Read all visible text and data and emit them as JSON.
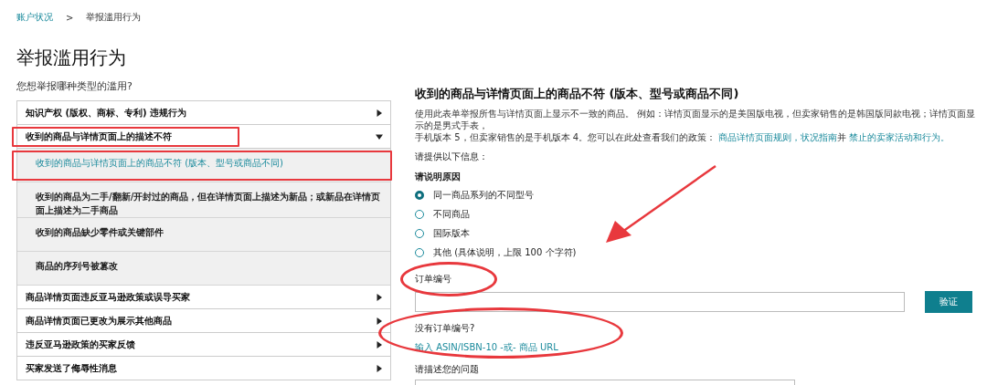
{
  "breadcrumb": [
    {
      "label": "账户状况",
      "kind": "link"
    },
    {
      "label": ">",
      "kind": "separator"
    },
    {
      "label": "举报滥用行为",
      "kind": "current"
    }
  ],
  "title": "举报滥用行为",
  "question": "您想举报哪种类型的滥用?",
  "categories": [
    {
      "label": "知识产权 (版权、商标、专利) 违规行为",
      "expanded": false
    },
    {
      "label": "收到的商品与详情页面上的描述不符",
      "expanded": true,
      "children": [
        {
          "label": "收到的商品与详情页面上的商品不符 (版本、型号或商品不同)",
          "selected": true
        },
        {
          "label": "收到的商品为二手/翻新/开封过的商品，但在详情页面上描述为新品；或新品在详情页面上描述为二手商品",
          "selected": false
        },
        {
          "label": "收到的商品缺少零件或关键部件",
          "selected": false
        },
        {
          "label": "商品的序列号被篡改",
          "selected": false
        }
      ]
    },
    {
      "label": "商品详情页面违反亚马逊政策或误导买家",
      "expanded": false
    },
    {
      "label": "商品详情页面已更改为展示其他商品",
      "expanded": false
    },
    {
      "label": "违反亚马逊政策的买家反馈",
      "expanded": false
    },
    {
      "label": "买家发送了侮辱性消息",
      "expanded": false
    }
  ],
  "detail": {
    "title": "收到的商品与详情页面上的商品不符 (版本、型号或商品不同)",
    "description": [
      {
        "kind": "text",
        "text": "使用此表单举报所售与详情页面上显示不一致的商品。 例如：详情页面显示的是美国版电视，但卖家销售的是韩国版同款电视；详情页面显示的是男式手表，"
      },
      {
        "kind": "text",
        "text": "手机版本 5，但卖家销售的是手机版本 4。您可以在此处查看我们的政策："
      },
      {
        "kind": "link",
        "text": "商品详情页面规则，"
      },
      {
        "kind": "link",
        "text": "状况指南"
      },
      {
        "kind": "text",
        "text": "并"
      },
      {
        "kind": "link",
        "text": "禁止的卖家活动和行为。"
      }
    ],
    "prompt": "请提供以下信息：",
    "reason_label": "请说明原因",
    "reasons": [
      {
        "label": "同一商品系列的不同型号",
        "selected": true
      },
      {
        "label": "不同商品",
        "selected": false
      },
      {
        "label": "国际版本",
        "selected": false
      },
      {
        "label": "其他 (具体说明，上限 100 个字符)",
        "selected": false
      }
    ],
    "order_label": "订单编号",
    "verify_button": "验证",
    "no_order_question": "没有订单编号?",
    "no_order_link": "输入 ASIN/ISBN-10 -或- 商品 URL",
    "describe_label": "请描述您的问题"
  }
}
